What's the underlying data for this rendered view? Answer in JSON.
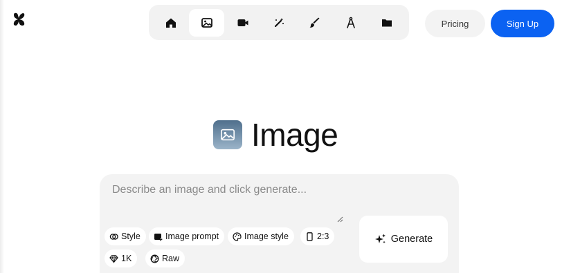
{
  "nav": {
    "tools": [
      {
        "icon": "home-icon",
        "active": false
      },
      {
        "icon": "image-icon",
        "active": true
      },
      {
        "icon": "video-camera-icon",
        "active": false
      },
      {
        "icon": "magic-wand-icon",
        "active": false
      },
      {
        "icon": "brush-icon",
        "active": false
      },
      {
        "icon": "compass-icon",
        "active": false
      },
      {
        "icon": "folder-icon",
        "active": false
      }
    ]
  },
  "header": {
    "pricing_label": "Pricing",
    "signup_label": "Sign Up"
  },
  "hero": {
    "title": "Image"
  },
  "prompt": {
    "placeholder": "Describe an image and click generate..."
  },
  "chips": {
    "style": "Style",
    "image_prompt": "Image prompt",
    "image_style": "Image style",
    "aspect_ratio": "2:3",
    "resolution": "1K",
    "raw": "Raw"
  },
  "generate_label": "Generate",
  "colors": {
    "accent": "#0b62f2",
    "panel": "#f3f3f3"
  }
}
